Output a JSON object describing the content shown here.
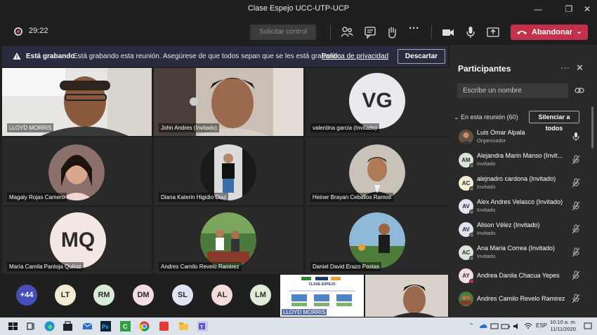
{
  "window": {
    "title": "Clase Espejo UCC-UTP-UCP"
  },
  "toolbar": {
    "timer": "29:22",
    "request_control": "Solicitar control",
    "leave_label": "Abandonar"
  },
  "banner": {
    "title": "Está grabando",
    "text": "Está grabando esta reunión. Asegúrese de que todos sepan que se les está grabando.",
    "link": "Política de privacidad",
    "dismiss": "Descartar"
  },
  "tiles": [
    {
      "name": "LLOYD MORRIS"
    },
    {
      "name": "John Andres (Invitado)"
    },
    {
      "name": "valentina garcia (Invitado)",
      "initials": "VG"
    },
    {
      "name": "Magaly Rojas Camero"
    },
    {
      "name": "Diana Katerin Higidio Diaz"
    },
    {
      "name": "Heiner Brayan Ceballos Ramos"
    },
    {
      "name": "María Camila Pantoja Quiroz",
      "initials": "MQ"
    },
    {
      "name": "Andres Camilo Revelo Ramirez"
    },
    {
      "name": "Daniel David Erazo Pastas"
    }
  ],
  "strip": {
    "overflow_count": "+44",
    "avatars": [
      "LT",
      "RM",
      "DM",
      "SL",
      "AL",
      "LM"
    ],
    "slide_title": "CLASE ESPEJO",
    "slide_name": "LLOYD MORRIS"
  },
  "panel": {
    "title": "Participantes",
    "search_placeholder": "Escribe un nombre",
    "section": "En esta reunión (60)",
    "mute_all": "Silenciar a todos",
    "participants": [
      {
        "name": "Luis Omar Alpala",
        "role": "Organizador",
        "initials": "",
        "mic": "on"
      },
      {
        "name": "Alejandra Marin Manso (Invit...",
        "role": "Invitado",
        "initials": "AM",
        "mic": "off"
      },
      {
        "name": "alejnadro cardona (Invitado)",
        "role": "Invitado",
        "initials": "AC",
        "mic": "off"
      },
      {
        "name": "Alex Andres Velasco (Invitado)",
        "role": "Invitado",
        "initials": "AV",
        "mic": "off"
      },
      {
        "name": "Alison Vélez (Invitado)",
        "role": "Invitado",
        "initials": "AV",
        "mic": "off"
      },
      {
        "name": "Ana Maria Correa (Invitado)",
        "role": "Invitado",
        "initials": "AC",
        "mic": "off"
      },
      {
        "name": "Andrea Danila Chacua Yepes",
        "role": "",
        "initials": "AY",
        "mic": "off"
      },
      {
        "name": "Andres Camilo Revelo Ramirez",
        "role": "",
        "initials": "",
        "mic": "off"
      }
    ]
  },
  "taskbar": {
    "lang": "ESP",
    "time": "10:10 a. m.",
    "date": "11/11/2020"
  },
  "colors": {
    "accent": "#6264a7",
    "leave": "#c4314b",
    "background": "#1f1f1f",
    "panel": "#292929"
  }
}
